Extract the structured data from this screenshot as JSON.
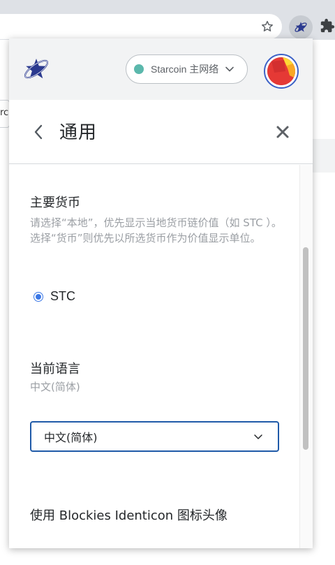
{
  "browser": {
    "star_icon": "star-outline",
    "extension_icon": "starmask-star",
    "puzzle_icon": "puzzle",
    "behind_tab_text": "rco"
  },
  "header": {
    "network_label": "Starcoin 主网络",
    "network_status_color": "#5bb8ac",
    "avatar_colors": [
      "#e53935",
      "#fdd835",
      "#3d62c7"
    ]
  },
  "title_bar": {
    "title": "通用"
  },
  "currency": {
    "title": "主要货币",
    "description": "请选择“本地”，优先显示当地货币链价值（如 STC ）。选择“货币”则优先以所选货币作为价值显示单位。",
    "options": [
      {
        "label": "STC",
        "selected": true
      }
    ]
  },
  "language": {
    "title": "当前语言",
    "current": "中文(简体)",
    "select_value": "中文(简体)"
  },
  "blockies": {
    "title": "使用 Blockies Identicon 图标头像"
  },
  "colors": {
    "accent": "#3a77e6",
    "select_border": "#1f5aa8"
  }
}
